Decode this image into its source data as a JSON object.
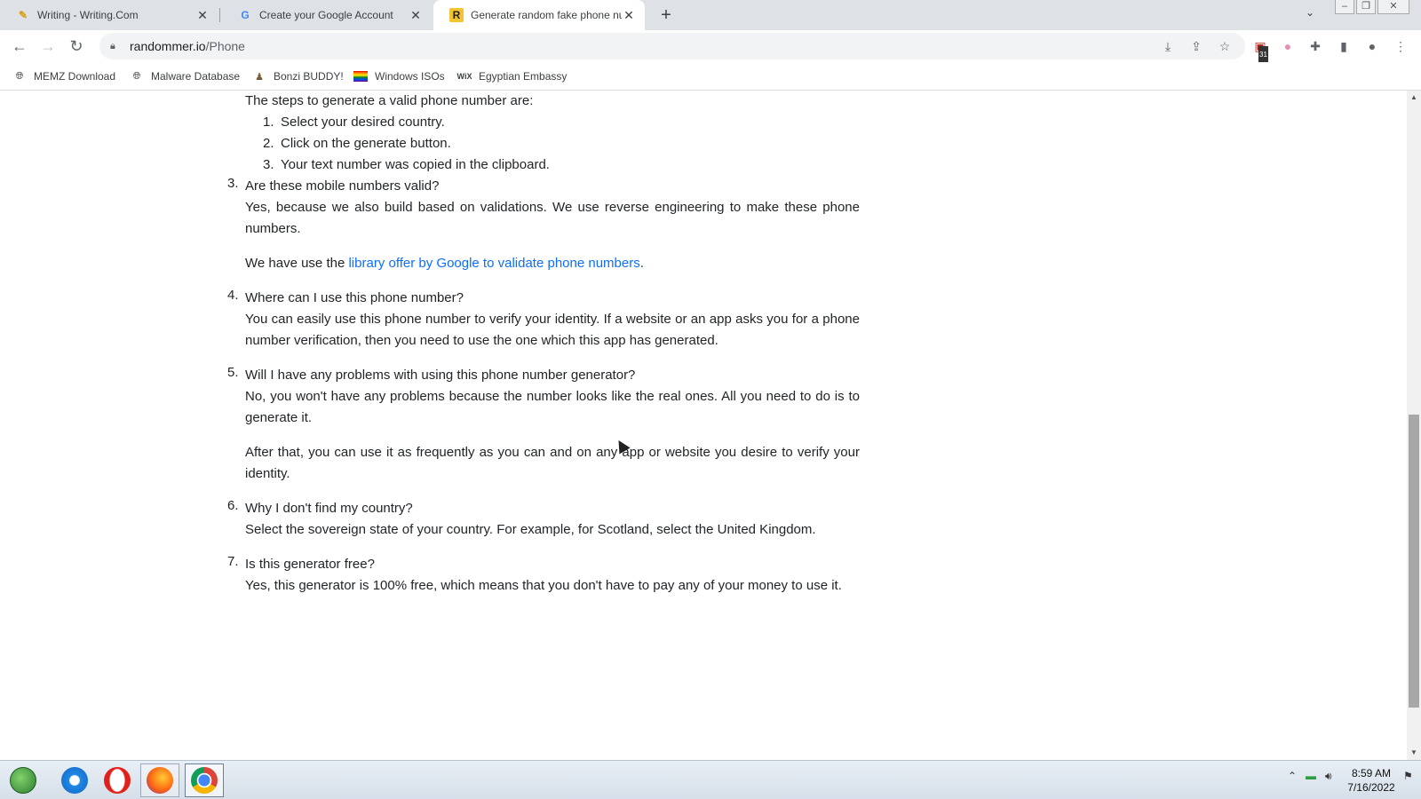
{
  "tabs": [
    {
      "title": "Writing - Writing.Com"
    },
    {
      "title": "Create your Google Account"
    },
    {
      "title": "Generate random fake phone nu"
    }
  ],
  "tab_close": "✕",
  "new_tab": "+",
  "address": {
    "domain": "randommer.io",
    "path": "/Phone"
  },
  "bookmarks": [
    {
      "label": "MEMZ Download"
    },
    {
      "label": "Malware Database"
    },
    {
      "label": "Bonzi BUDDY!"
    },
    {
      "label": "Windows ISOs"
    },
    {
      "label": "Egyptian Embassy"
    }
  ],
  "extension_badge": "31",
  "faq": {
    "intro": "The steps to generate a valid phone number are:",
    "steps": [
      {
        "num": "1.",
        "text": "Select your desired country."
      },
      {
        "num": "2.",
        "text": "Click on the generate button."
      },
      {
        "num": "3.",
        "text": "Your text number was copied in the clipboard."
      }
    ],
    "items": [
      {
        "num": "3.",
        "question": "Are these mobile numbers valid?",
        "answer": "Yes, because we also build based on validations. We use reverse engineering to make these phone numbers.",
        "extra_pre": "We have use the ",
        "extra_link": "library offer by Google to validate phone numbers",
        "extra_post": "."
      },
      {
        "num": "4.",
        "question": "Where can I use this phone number?",
        "answer": "You can easily use this phone number to verify your identity. If a website or an app asks you for a phone number verification, then you need to use the one which this app has generated."
      },
      {
        "num": "5.",
        "question": "Will I have any problems with using this phone number generator?",
        "answer": "No, you won't have any problems because the number looks like the real ones. All you need to do is to generate it.",
        "extra": "After that, you can use it as frequently as you can and on any app or website you desire to verify your identity."
      },
      {
        "num": "6.",
        "question": "Why I don't find my country?",
        "answer": "Select the sovereign state of your country. For example, for Scotland, select the United Kingdom."
      },
      {
        "num": "7.",
        "question": "Is this generator free?",
        "answer": "Yes, this generator is 100% free, which means that you don't have to pay any of your money to use it."
      }
    ]
  },
  "clock": {
    "time": "8:59 AM",
    "date": "7/16/2022"
  },
  "colors": {
    "link": "#0d6efd",
    "tabbar": "#dee1e6",
    "text": "#212529"
  }
}
